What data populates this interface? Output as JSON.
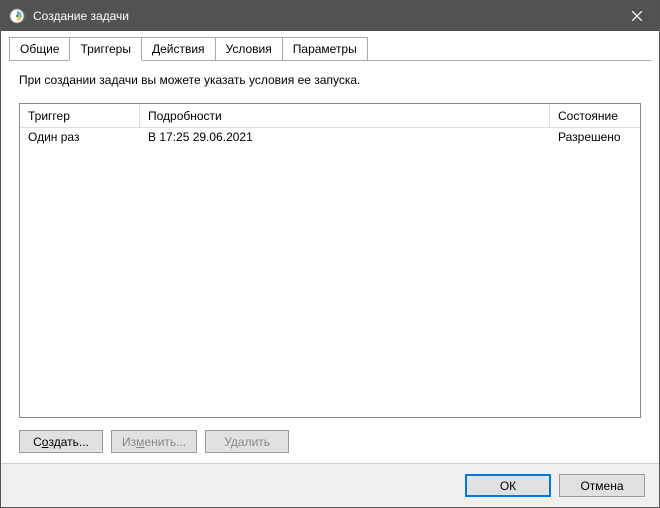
{
  "titlebar": {
    "title": "Создание задачи"
  },
  "tabs": {
    "general": "Общие",
    "triggers": "Триггеры",
    "actions": "Действия",
    "conditions": "Условия",
    "settings": "Параметры"
  },
  "hint": "При создании задачи вы можете указать условия ее запуска.",
  "columns": {
    "trigger": "Триггер",
    "details": "Подробности",
    "state": "Состояние"
  },
  "rows": [
    {
      "trigger": "Один раз",
      "details": "В 17:25 29.06.2021",
      "state": "Разрешено"
    }
  ],
  "buttons": {
    "create_pre": "С",
    "create_u": "о",
    "create_post": "здать...",
    "edit_pre": "Из",
    "edit_u": "м",
    "edit_post": "енить...",
    "delete": "Удалить"
  },
  "footer": {
    "ok": "ОК",
    "cancel": "Отмена"
  }
}
